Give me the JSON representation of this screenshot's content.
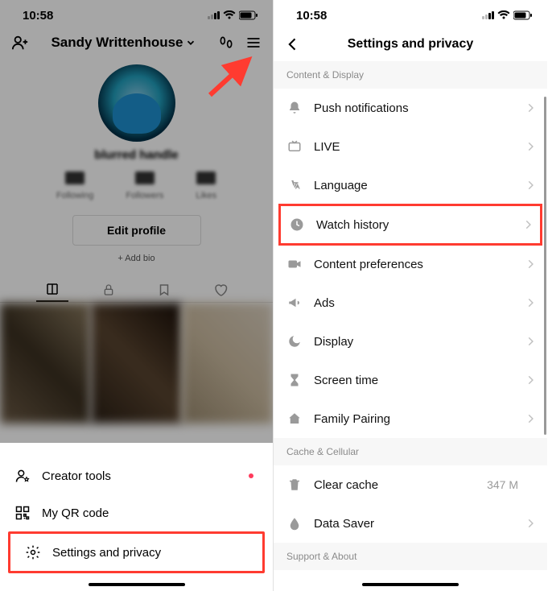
{
  "statusBar": {
    "time": "10:58"
  },
  "left": {
    "profileName": "Sandy Writtenhouse",
    "handle": "blurred handle",
    "editProfile": "Edit profile",
    "addBio": "+ Add bio",
    "sheet": {
      "creatorTools": "Creator tools",
      "qrCode": "My QR code",
      "settings": "Settings and privacy"
    }
  },
  "right": {
    "title": "Settings and privacy",
    "sections": {
      "content": "Content & Display",
      "cache": "Cache & Cellular",
      "support": "Support & About"
    },
    "rows": {
      "push": "Push notifications",
      "live": "LIVE",
      "lang": "Language",
      "watch": "Watch history",
      "pref": "Content preferences",
      "ads": "Ads",
      "display": "Display",
      "screen": "Screen time",
      "family": "Family Pairing",
      "clear": "Clear cache",
      "clearValue": "347 M",
      "data": "Data Saver"
    }
  }
}
